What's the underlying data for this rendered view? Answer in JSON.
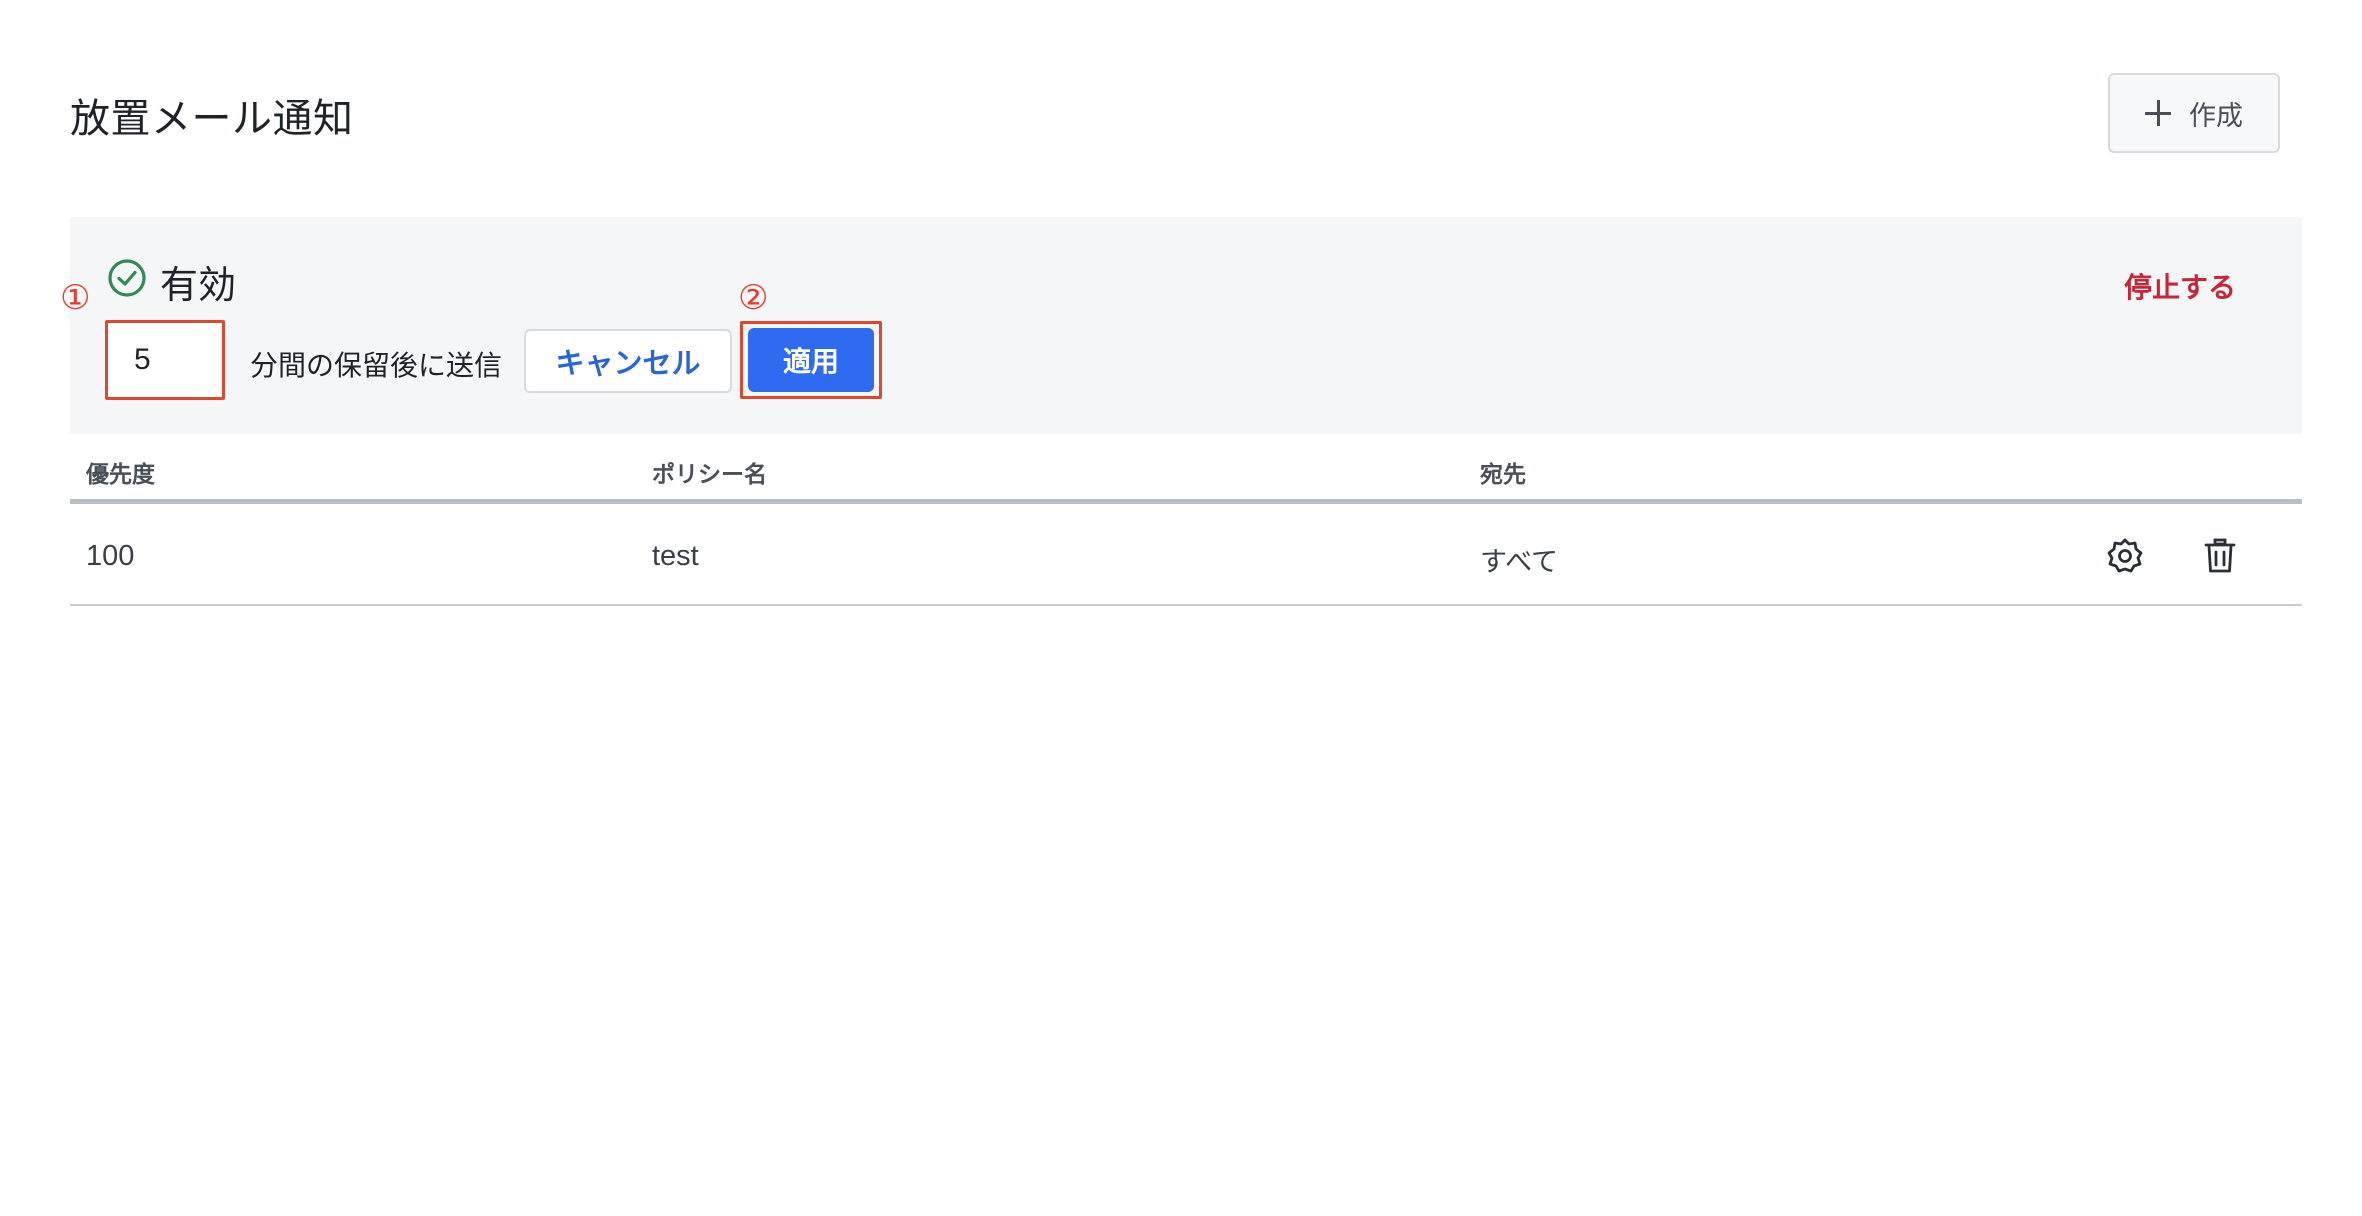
{
  "header": {
    "title": "放置メール通知",
    "create_label": "作成",
    "create_icon": "plus-icon"
  },
  "settings": {
    "status_icon": "check-circle-icon",
    "status_color": "#2e8b57",
    "status_label": "有効",
    "stop_label": "停止する",
    "stop_color": "#c8253a",
    "delay_minutes": "5",
    "delay_suffix": "分間の保留後に送信",
    "cancel_label": "キャンセル",
    "apply_label": "適用",
    "apply_color": "#2f6bf0",
    "annotation_color": "#e0472f",
    "marker_1": "①",
    "marker_2": "②"
  },
  "table": {
    "columns": [
      "優先度",
      "ポリシー名",
      "宛先"
    ],
    "rows": [
      {
        "priority": "100",
        "policy": "test",
        "destination": "すべて",
        "actions": [
          "gear-icon",
          "trash-icon"
        ]
      }
    ]
  }
}
